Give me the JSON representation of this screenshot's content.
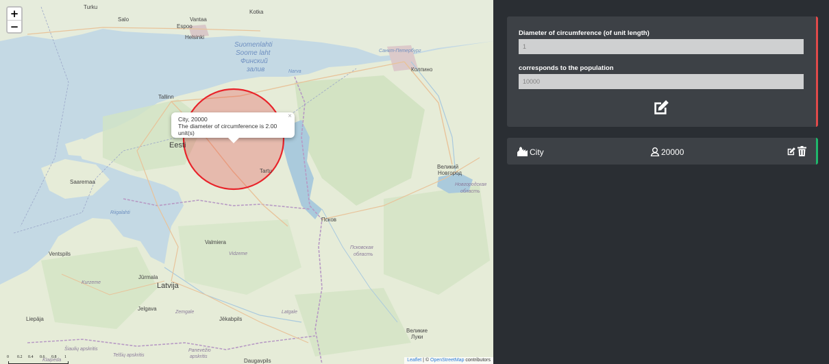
{
  "map": {
    "zoom_in": "+",
    "zoom_out": "−",
    "popup": {
      "close": "×",
      "line1": "City, 20000",
      "line2": "The diameter of circumference is 2.00 unit(s)"
    },
    "attribution": {
      "leaflet": "Leaflet",
      "sep": " | © ",
      "osm": "OpenStreetMap",
      "suffix": " contributors"
    },
    "scale": {
      "t0": "0",
      "t1": "0.2",
      "t2": "0.4",
      "t3": "0.6",
      "t4": "0.8",
      "t5": "1"
    },
    "labels": {
      "turku": "Turku",
      "salo": "Salo",
      "vantaa": "Vantaa",
      "kotka": "Kotka",
      "espoo": "Espoo",
      "helsinki": "Helsinki",
      "gulf1": "Suomenlahti",
      "gulf2": "Soome laht",
      "gulf3": "Финский",
      "gulf4": "залив",
      "spb": "Санкт-Петербург",
      "kolpino": "Колпино",
      "narva": "Narva",
      "tallinn": "Tallinn",
      "eesti": "Eesti",
      "tartu": "Tartu",
      "saaremaa": "Saaremaa",
      "riga_gulf": "Riigalahti",
      "pskov": "Псков",
      "pskov_obl": "Псковская",
      "pskov_obl2": "область",
      "novgorod": "Великий",
      "novgorod2": "Новгород",
      "novg_obl": "Новгородская",
      "novg_obl2": "область",
      "valmiera": "Valmiera",
      "vidzeme": "Vidzeme",
      "ventspils": "Ventspils",
      "jurmala": "Jūrmala",
      "latvija": "Latvija",
      "kurzeme": "Kurzeme",
      "jelgava": "Jelgava",
      "zemgale": "Zemgale",
      "jekabpils": "Jēkabpils",
      "latgale": "Latgale",
      "liepaja": "Liepāja",
      "velikie": "Великие",
      "velikie2": "Луки",
      "siauliai": "Šiaulių apskritis",
      "telsiai": "Telšių apskritis",
      "panevezys": "Panevėžio",
      "panevezys2": "apskritis",
      "daugavpils": "Daugavpils",
      "klaipeda": "Klaipėda"
    },
    "circle": {
      "color": "#e8232a",
      "fill": "rgba(232,35,42,0.25)"
    }
  },
  "panel": {
    "settings": {
      "diameter_label": "Diameter of circumference (of unit length)",
      "diameter_value": "1",
      "population_label": "corresponds to the population",
      "population_value": "10000",
      "accent": "#e24a4a"
    },
    "city": {
      "name": "City",
      "population": "20000",
      "accent": "#1fb86c"
    }
  }
}
